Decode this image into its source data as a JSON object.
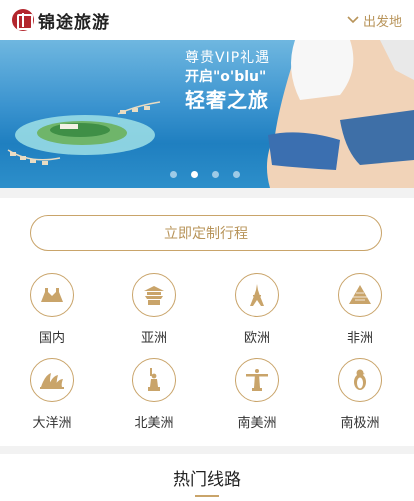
{
  "header": {
    "logo_text": "锦途旅游",
    "departure_label": "出发地",
    "accent_color": "#b8945a"
  },
  "banner": {
    "line1": "尊贵VIP礼遇",
    "line2": "开启\"o'blu\"",
    "line3": "轻奢之旅",
    "slide_count": 4,
    "active_slide": 2
  },
  "cta": {
    "label": "立即定制行程"
  },
  "destinations": [
    {
      "label": "国内",
      "icon": "great-wall-icon"
    },
    {
      "label": "亚洲",
      "icon": "temple-icon"
    },
    {
      "label": "欧洲",
      "icon": "eiffel-tower-icon"
    },
    {
      "label": "非洲",
      "icon": "pyramid-icon"
    },
    {
      "label": "大洋洲",
      "icon": "opera-house-icon"
    },
    {
      "label": "北美洲",
      "icon": "statue-of-liberty-icon"
    },
    {
      "label": "南美洲",
      "icon": "christ-redeemer-icon"
    },
    {
      "label": "南极洲",
      "icon": "penguin-icon"
    }
  ],
  "hot_routes": {
    "title": "热门线路"
  }
}
